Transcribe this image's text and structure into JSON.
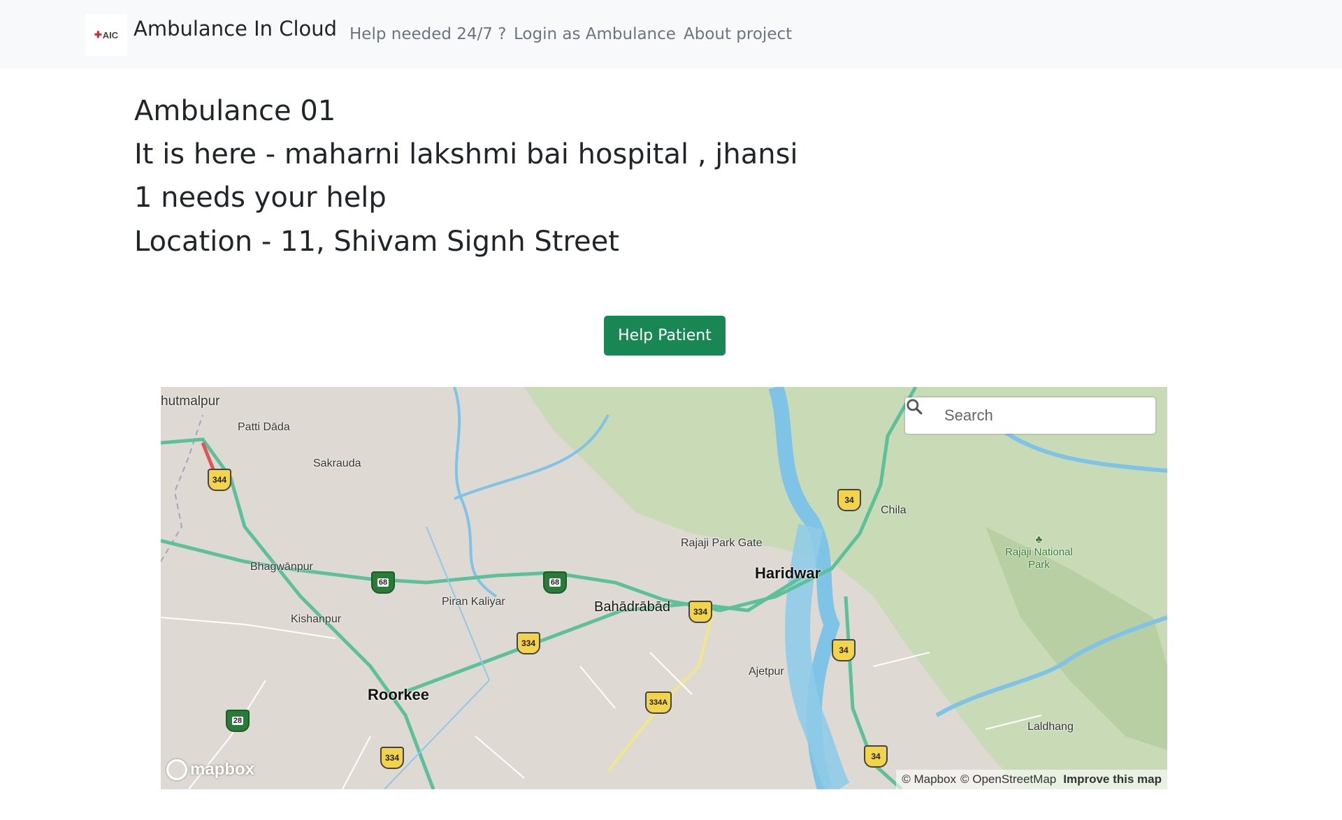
{
  "navbar": {
    "logo_text": "AIC",
    "brand": "Ambulance In Cloud",
    "links": [
      {
        "label": "Help needed 24/7 ?"
      },
      {
        "label": "Login as Ambulance"
      },
      {
        "label": "About project"
      }
    ]
  },
  "content": {
    "ambulance_name": "Ambulance 01",
    "current_location": "It is here - maharni lakshmi bai hospital , jhansi",
    "help_count": "1 needs your help",
    "patient_location": "Location - 11, Shivam Signh Street"
  },
  "help_button": {
    "label": "Help Patient",
    "color": "#198754"
  },
  "map": {
    "search_placeholder": "Search",
    "labels": {
      "patti_dada": "Patti Dāda",
      "sakrauda": "Sakrauda",
      "bhagwanpur": "Bhagwānpur",
      "kishanpur": "Kishanpur",
      "piran_kaliyar": "Piran Kaliyar",
      "rajaji_park_gate": "Rajaji Park Gate",
      "haridwar": "Haridwar",
      "bahadrabad": "Bahādrābād",
      "roorkee": "Roorkee",
      "ajetpur": "Ajetpur",
      "chila": "Chila",
      "rajaji_national_park_1": "Rajaji National",
      "rajaji_national_park_2": "Park",
      "laldhang": "Laldhang",
      "jhutmalpur": "hutmalpur"
    },
    "shields": {
      "nh344": "344",
      "nh68_a": "68",
      "nh68_b": "68",
      "nh334_a": "334",
      "nh334_b": "334",
      "nh334_c": "334",
      "nh334a": "334A",
      "nh34_a": "34",
      "nh34_b": "34",
      "nh34_c": "34",
      "nh28": "28"
    },
    "logo": "mapbox",
    "attribution": {
      "mapbox": "© Mapbox",
      "osm": "© OpenStreetMap",
      "improve": "Improve this map"
    },
    "colors": {
      "land": "#dedad3",
      "forest": "#c8dbb6",
      "water": "#7fc4e6",
      "road": "#5cc09a"
    }
  }
}
